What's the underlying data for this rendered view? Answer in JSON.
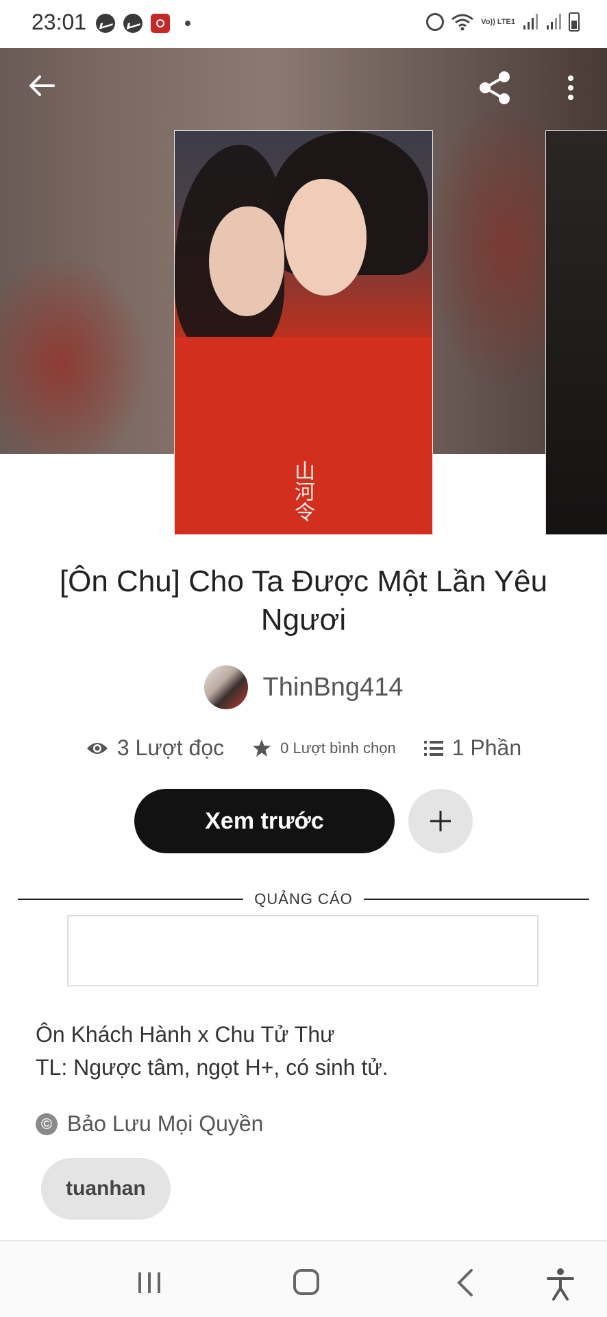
{
  "status_bar": {
    "time": "23:01",
    "volte": "Vo)) LTE1",
    "left_icons": [
      "messenger-icon",
      "messenger-icon",
      "screen-record-icon",
      "notification-dot"
    ],
    "right_icons": [
      "alarm-icon",
      "wifi-icon",
      "volte-icon",
      "signal-icon",
      "signal-icon",
      "battery-icon"
    ]
  },
  "toolbar": {
    "back_icon": "arrow-left-icon",
    "share_icon": "share-icon",
    "more_icon": "more-vertical-icon"
  },
  "cover": {
    "calligraphy": "山河令"
  },
  "story": {
    "title": "[Ôn Chu] Cho Ta Được Một Lần Yêu Ngươi",
    "author": "ThinBng414",
    "reads": "3 Lượt đọc",
    "votes": "0 Lượt bình chọn",
    "parts": "1 Phần",
    "read_button": "Xem trước",
    "add_button_icon": "plus-icon",
    "ad_label": "QUẢNG CÁO",
    "description_line1": "Ôn Khách Hành x Chu Tử Thư",
    "description_line2": "TL: Ngược tâm, ngọt H+, có sinh tử.",
    "copyright": "Bảo Lưu Mọi Quyền",
    "tag": "tuanhan"
  },
  "nav_bar": {
    "icons": [
      "recent-apps-icon",
      "home-icon",
      "back-icon",
      "accessibility-icon"
    ]
  },
  "colors": {
    "button_dark": "#121212",
    "chip_bg": "#e4e4e4",
    "robe_red": "#d32f1f"
  }
}
